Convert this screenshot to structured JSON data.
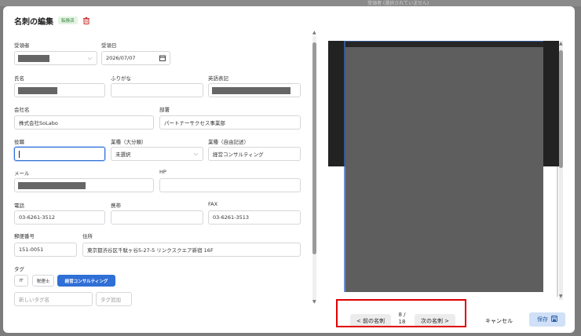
{
  "background": {
    "text": "受領者 (選択されていません)"
  },
  "header": {
    "title": "名刺の編集",
    "badge": "転換済"
  },
  "form": {
    "recipient": {
      "label": "受領者"
    },
    "received_date": {
      "label": "受領日",
      "value": "2026/07/07"
    },
    "name": {
      "label": "氏名"
    },
    "furigana": {
      "label": "ふりがな"
    },
    "english_name": {
      "label": "英語表記"
    },
    "company": {
      "label": "会社名",
      "value": "株式会社SoLabo"
    },
    "department": {
      "label": "部署",
      "value": "パートナーサクセス事業部"
    },
    "position": {
      "label": "役職",
      "value": ""
    },
    "industry_major": {
      "label": "業種（大分類）",
      "value": "未選択"
    },
    "industry_free": {
      "label": "業種（自由記述）",
      "value": "経営コンサルティング"
    },
    "email": {
      "label": "メール"
    },
    "hp": {
      "label": "HP",
      "value": ""
    },
    "phone": {
      "label": "電話",
      "value": "03-6261-3512"
    },
    "mobile": {
      "label": "携帯",
      "value": ""
    },
    "fax": {
      "label": "FAX",
      "value": "03-6261-3513"
    },
    "postal_code": {
      "label": "郵便番号",
      "value": "151-0051"
    },
    "address": {
      "label": "住所",
      "value": "東京都渋谷区千駄ヶ谷5-27-5 リンクスクエア新宿 16F"
    },
    "tags": {
      "label": "タグ",
      "items": [
        {
          "label": "IT",
          "active": false
        },
        {
          "label": "税理士",
          "active": false
        },
        {
          "label": "経営コンサルティング",
          "active": true
        }
      ],
      "new_tag_placeholder": "新しいタグ名",
      "add_label": "タグ追加"
    }
  },
  "footer": {
    "prev_label": "< 前の名刺",
    "next_label": "次の名刺 >",
    "page_current": "8 /",
    "page_total": "18",
    "cancel_label": "キャンセル",
    "save_label": "保存"
  },
  "colors": {
    "accent": "#2f6fd6",
    "save_bg": "#cfe0f7",
    "highlight": "#e00000",
    "badge_green": "#2e7d32"
  }
}
